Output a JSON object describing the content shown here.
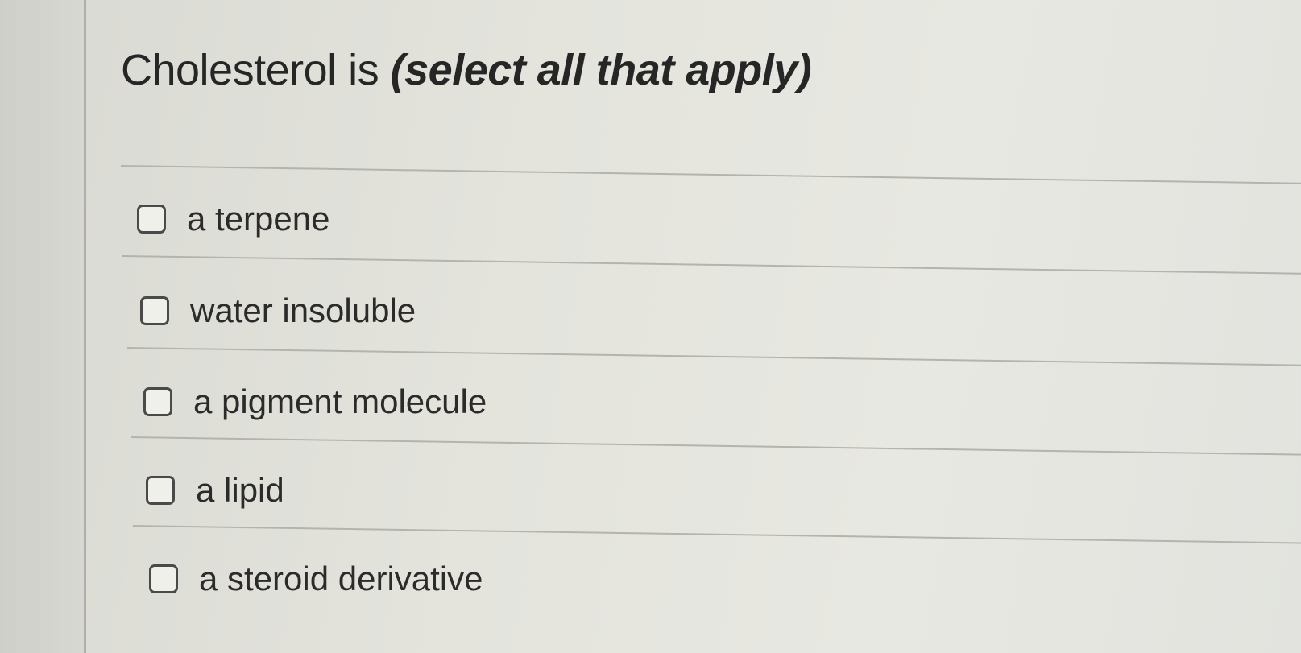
{
  "question": {
    "prefix": "Cholesterol is ",
    "instruction": "(select all that apply)"
  },
  "options": [
    {
      "label": "a terpene",
      "checked": false
    },
    {
      "label": "water insoluble",
      "checked": false
    },
    {
      "label": "a pigment molecule",
      "checked": false
    },
    {
      "label": "a lipid",
      "checked": false
    },
    {
      "label": "a steroid derivative",
      "checked": false
    }
  ]
}
